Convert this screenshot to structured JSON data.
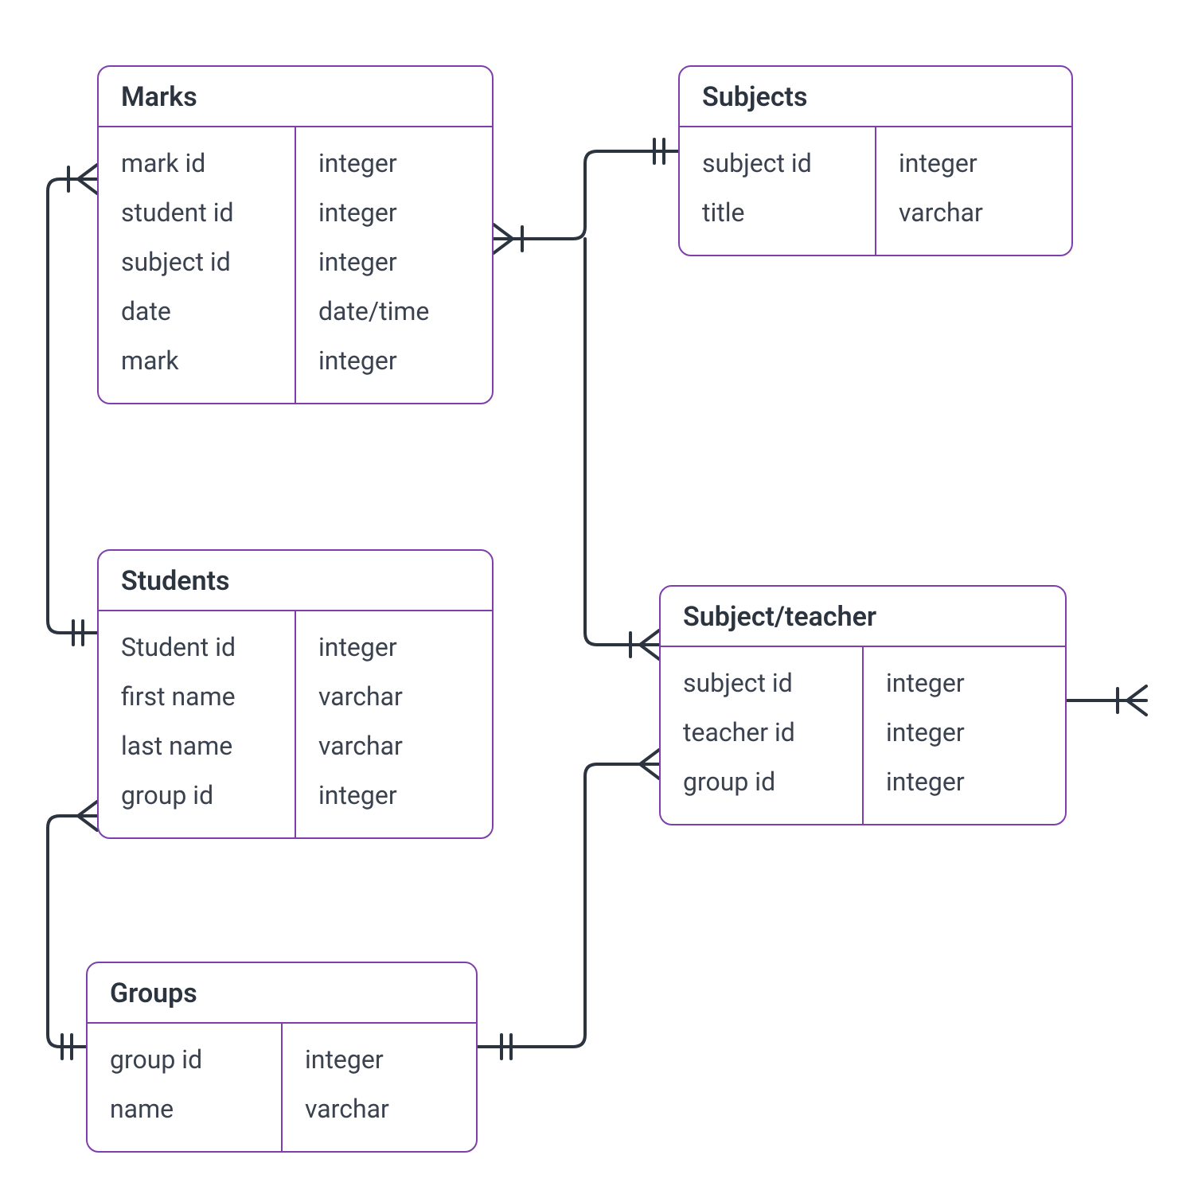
{
  "entities": {
    "marks": {
      "title": "Marks",
      "fields": [
        {
          "name": "mark id",
          "type": "integer"
        },
        {
          "name": "student id",
          "type": "integer"
        },
        {
          "name": "subject id",
          "type": "integer"
        },
        {
          "name": "date",
          "type": "date/time"
        },
        {
          "name": "mark",
          "type": "integer"
        }
      ]
    },
    "subjects": {
      "title": "Subjects",
      "fields": [
        {
          "name": "subject id",
          "type": "integer"
        },
        {
          "name": "title",
          "type": "varchar"
        }
      ]
    },
    "students": {
      "title": "Students",
      "fields": [
        {
          "name": "Student id",
          "type": "integer"
        },
        {
          "name": "first name",
          "type": "varchar"
        },
        {
          "name": "last name",
          "type": "varchar"
        },
        {
          "name": "group id",
          "type": "integer"
        }
      ]
    },
    "subjectteacher": {
      "title": "Subject/teacher",
      "fields": [
        {
          "name": "subject id",
          "type": "integer"
        },
        {
          "name": "teacher id",
          "type": "integer"
        },
        {
          "name": "group id",
          "type": "integer"
        }
      ]
    },
    "groups": {
      "title": "Groups",
      "fields": [
        {
          "name": "group id",
          "type": "integer"
        },
        {
          "name": "name",
          "type": "varchar"
        }
      ]
    }
  },
  "relationships": [
    {
      "from": "Students",
      "from_end": "one-mandatory",
      "to": "Marks",
      "to_end": "many-mandatory"
    },
    {
      "from": "Subjects",
      "from_end": "one-mandatory",
      "to": "Marks",
      "to_end": "many-mandatory"
    },
    {
      "from": "Subjects",
      "from_end": "one-mandatory",
      "to": "Subject/teacher",
      "to_end": "many-mandatory"
    },
    {
      "from": "Groups",
      "from_end": "one-mandatory",
      "to": "Students",
      "to_end": "many-mandatory"
    },
    {
      "from": "Groups",
      "from_end": "one-mandatory",
      "to": "Subject/teacher",
      "to_end": "many-mandatory"
    },
    {
      "from": "Subject/teacher",
      "from_end": "unspecified",
      "to": "(external)",
      "to_end": "many-mandatory"
    }
  ]
}
